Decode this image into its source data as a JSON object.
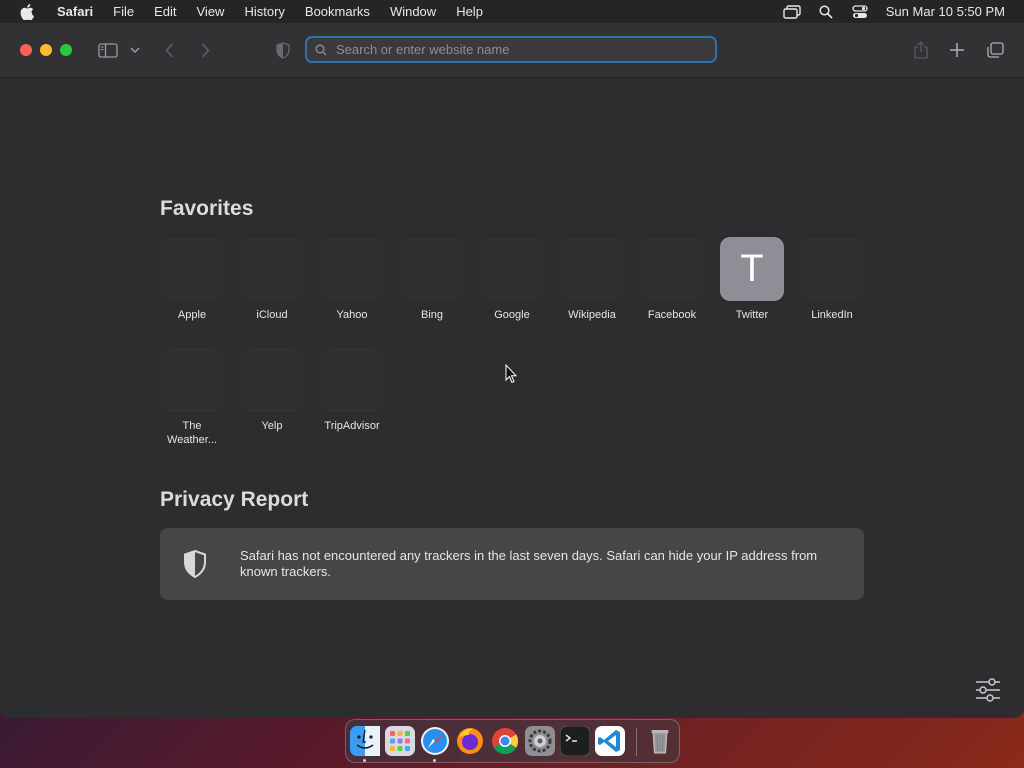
{
  "menubar": {
    "app_name": "Safari",
    "items": [
      "File",
      "Edit",
      "View",
      "History",
      "Bookmarks",
      "Window",
      "Help"
    ],
    "clock": "Sun Mar 10  5:50 PM"
  },
  "toolbar": {
    "address_placeholder": "Search or enter website name"
  },
  "favorites": {
    "title": "Favorites",
    "items": [
      {
        "label": "Apple",
        "letter": ""
      },
      {
        "label": "iCloud",
        "letter": ""
      },
      {
        "label": "Yahoo",
        "letter": ""
      },
      {
        "label": "Bing",
        "letter": ""
      },
      {
        "label": "Google",
        "letter": ""
      },
      {
        "label": "Wikipedia",
        "letter": ""
      },
      {
        "label": "Facebook",
        "letter": ""
      },
      {
        "label": "Twitter",
        "letter": "T"
      },
      {
        "label": "LinkedIn",
        "letter": ""
      },
      {
        "label": "The Weather...",
        "letter": ""
      },
      {
        "label": "Yelp",
        "letter": ""
      },
      {
        "label": "TripAdvisor",
        "letter": ""
      }
    ]
  },
  "privacy": {
    "title": "Privacy Report",
    "text": "Safari has not encountered any trackers in the last seven days. Safari can hide your IP address from known trackers."
  },
  "dock": {
    "apps": [
      "finder",
      "launchpad",
      "safari",
      "firefox",
      "chrome",
      "system-settings",
      "terminal",
      "vscode",
      "trash"
    ]
  },
  "colors": {
    "close": "#ff5f57",
    "minimize": "#febc2e",
    "maximize": "#28c840",
    "focus_ring": "#2f6fb3"
  }
}
